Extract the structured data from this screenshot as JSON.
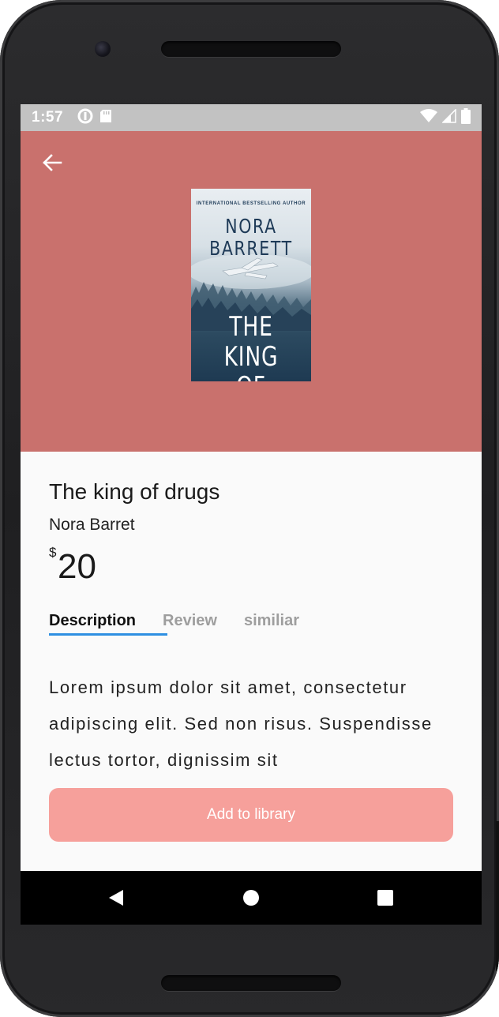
{
  "status_bar": {
    "time": "1:57",
    "left_icons": [
      "data-saver-icon",
      "sd-card-icon"
    ],
    "right_icons": [
      "wifi-icon",
      "signal-icon",
      "battery-icon"
    ]
  },
  "hero": {
    "background_color": "#c9716d",
    "back_icon": "arrow-left-icon",
    "cover": {
      "tagline": "INTERNATIONAL BESTSELLING AUTHOR",
      "author_line1": "NORA",
      "author_line2": "BARRETT",
      "title_line1": "THE KING",
      "title_line2": "OF DRUGS"
    }
  },
  "book": {
    "title": "The king of drugs",
    "author": "Nora Barret",
    "price_currency": "$",
    "price": "20"
  },
  "tabs": {
    "items": [
      {
        "label": "Description",
        "active": true
      },
      {
        "label": "Review",
        "active": false
      },
      {
        "label": "similiar",
        "active": false
      }
    ],
    "accent_color": "#2e8fe2"
  },
  "description": "Lorem ipsum dolor sit amet, consectetur adipiscing elit. Sed non risus. Suspendisse lectus tortor, dignissim sit",
  "cta": {
    "label": "Add to library",
    "color": "#f6a09b"
  },
  "nav_bar": {
    "buttons": [
      "back-triangle-icon",
      "home-circle-icon",
      "recents-square-icon"
    ]
  }
}
